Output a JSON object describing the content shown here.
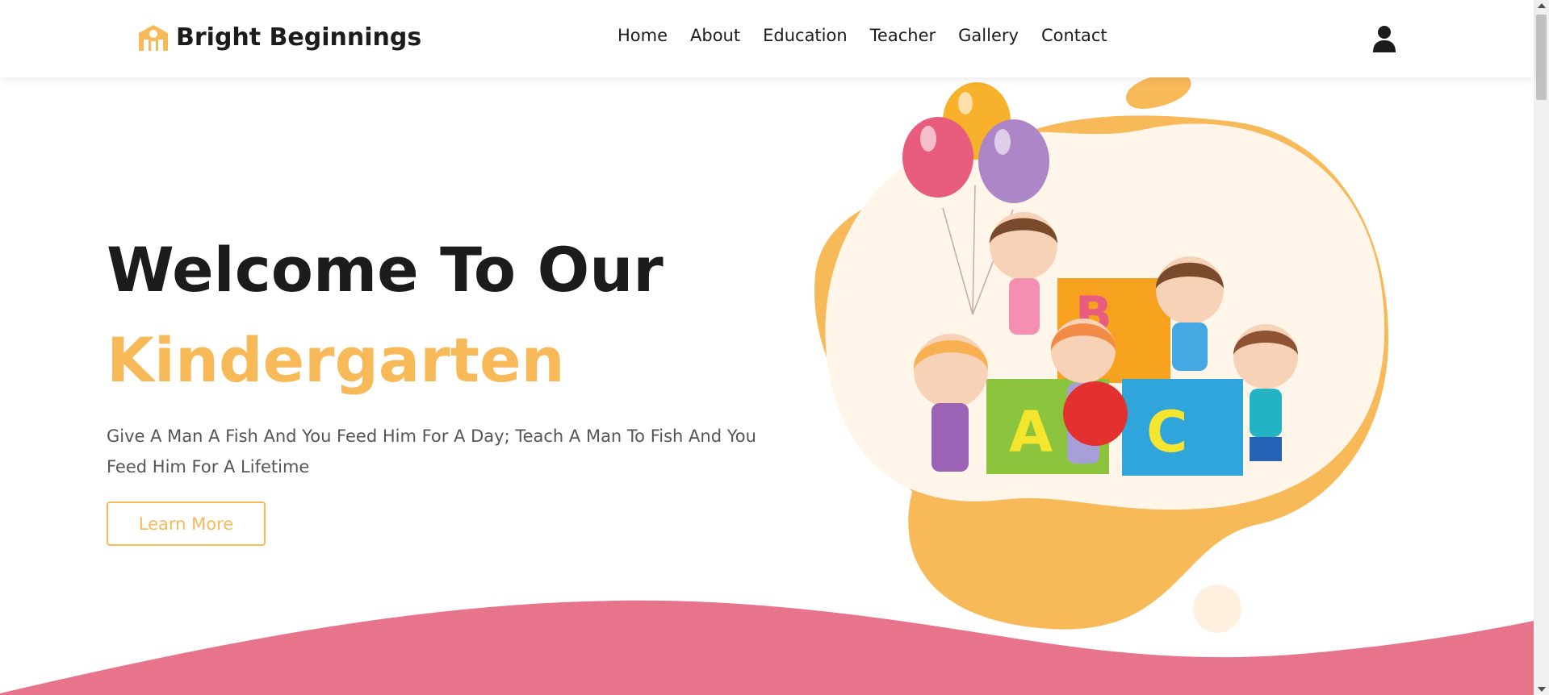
{
  "brand": {
    "name": "Bright Beginnings",
    "logo_icon": "school-icon"
  },
  "nav": {
    "items": [
      "Home",
      "About",
      "Education",
      "Teacher",
      "Gallery",
      "Contact"
    ]
  },
  "header": {
    "user_icon": "user-icon"
  },
  "hero": {
    "title": "Welcome To Our",
    "accent": "Kindergarten",
    "text": "Give A Man A Fish And You Feed Him For A Day; Teach A Man To Fish And You Feed Him For A Lifetime",
    "button_label": "Learn More"
  },
  "illustration": {
    "blocks": [
      "A",
      "B",
      "C"
    ]
  },
  "colors": {
    "accent": "#f8b959",
    "pink": "#e8748c",
    "dark": "#1c1c1c",
    "cream": "#fff5e8"
  }
}
